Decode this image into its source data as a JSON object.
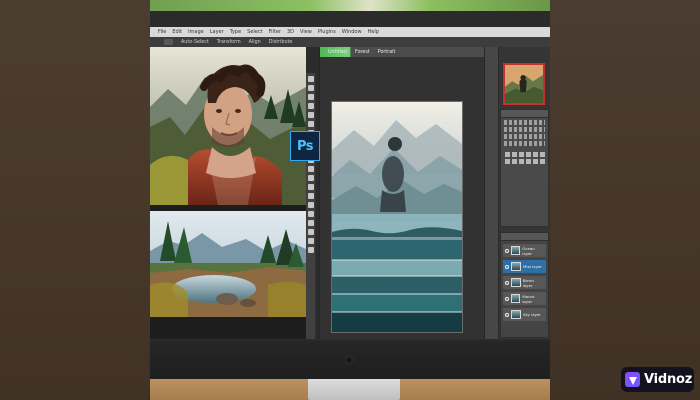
{
  "menubar": {
    "items": [
      "File",
      "Edit",
      "Image",
      "Layer",
      "Type",
      "Select",
      "Filter",
      "3D",
      "View",
      "Plugins",
      "Window",
      "Help"
    ]
  },
  "options": {
    "items": [
      "Auto-Select",
      "Transform",
      "Align",
      "Distribute"
    ]
  },
  "document": {
    "tabs": [
      "Untitled",
      "Forest",
      "Portrait"
    ]
  },
  "layers": {
    "items": [
      "Ocean layer",
      "Mist layer",
      "Blend layer",
      "Mount layer",
      "Sky layer"
    ]
  },
  "branding": {
    "ps_text": "Ps",
    "vidnoz_text": "Vidnoz"
  }
}
